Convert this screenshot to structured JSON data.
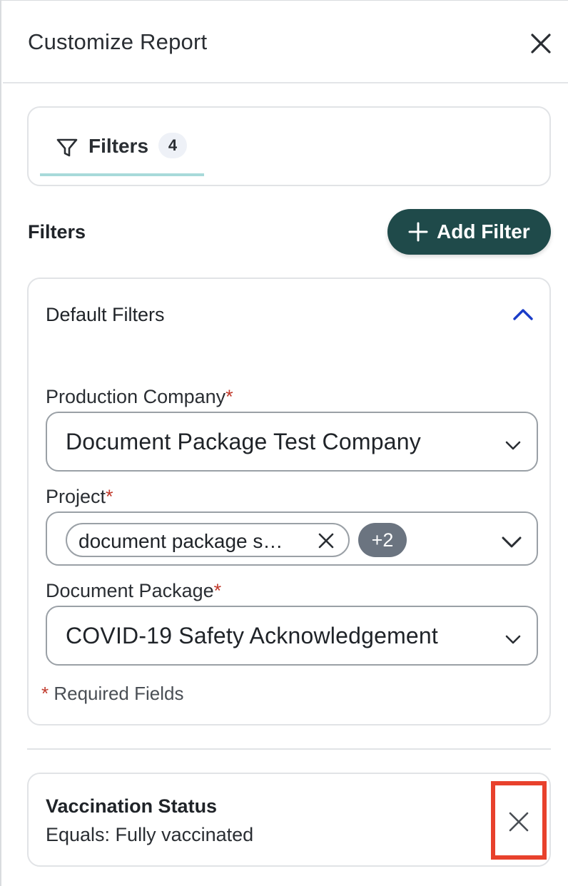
{
  "header": {
    "title": "Customize Report"
  },
  "tabs": [
    {
      "label": "Filters",
      "count": "4",
      "icon": "filter-icon"
    }
  ],
  "filters_section": {
    "title": "Filters",
    "add_button_label": "Add Filter"
  },
  "default_filters": {
    "title": "Default Filters",
    "fields": {
      "production_company": {
        "label": "Production Company",
        "required_mark": "*",
        "value": "Document Package Test Company"
      },
      "project": {
        "label": "Project",
        "required_mark": "*",
        "chip_value": "document package s…",
        "more_count": "+2"
      },
      "document_package": {
        "label": "Document Package",
        "required_mark": "*",
        "value": "COVID-19 Safety Acknowledgement"
      }
    },
    "required_note_mark": "*",
    "required_note": "Required Fields"
  },
  "applied_filters": [
    {
      "title": "Vaccination Status",
      "condition": "Equals: Fully vaccinated"
    }
  ],
  "colors": {
    "primary_button": "#1f4a4a",
    "tab_underline": "#a8dada",
    "required": "#c0392b",
    "chevron_up": "#1a3cc8",
    "highlight_box": "#e8412c",
    "badge": "#6b7480"
  }
}
